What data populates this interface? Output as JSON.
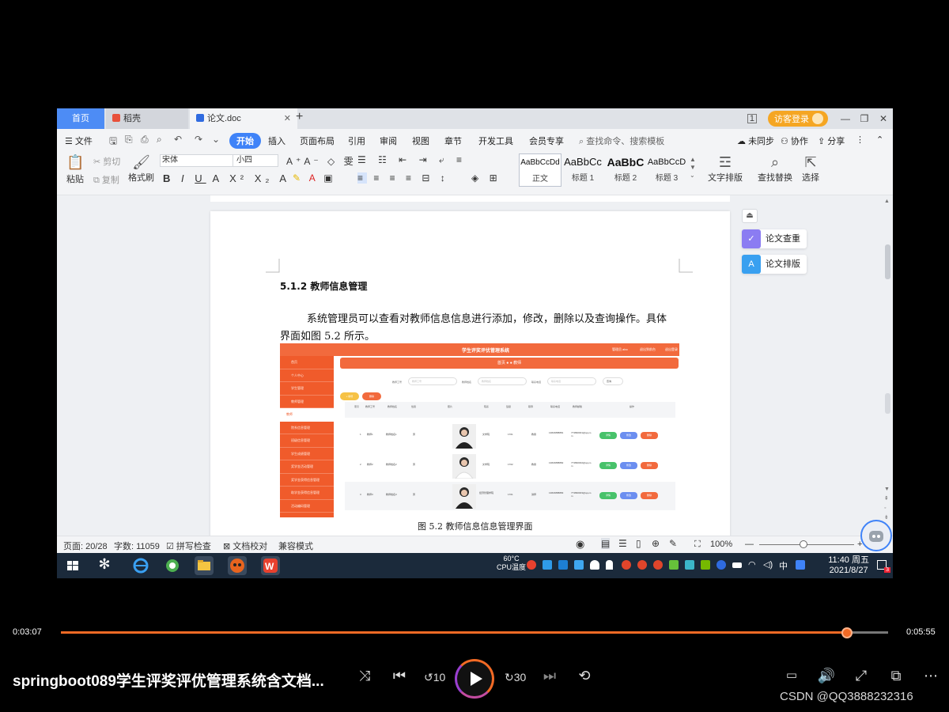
{
  "wps": {
    "tabs": [
      {
        "label": "首页"
      },
      {
        "label": "稻壳"
      },
      {
        "label": "论文.doc"
      }
    ],
    "login_label": "访客登录",
    "menu": {
      "file": "文件",
      "start": "开始",
      "items": [
        "插入",
        "页面布局",
        "引用",
        "审阅",
        "视图",
        "章节",
        "开发工具",
        "会员专享"
      ],
      "search_placeholder": "查找命令、搜索模板",
      "right": [
        "未同步",
        "协作",
        "分享"
      ]
    },
    "ribbon": {
      "paste": "粘贴",
      "cut": "剪切",
      "copy": "复制",
      "format_painter": "格式刷",
      "font": "宋体",
      "size": "小四",
      "styles": [
        {
          "preview": "AaBbCcDd",
          "label": "正文"
        },
        {
          "preview": "AaBbCc",
          "label": "标题 1"
        },
        {
          "preview": "AaBbC",
          "label": "标题 2"
        },
        {
          "preview": "AaBbCcD",
          "label": "标题 3"
        }
      ],
      "text_layout": "文字排版",
      "find_replace": "查找替换",
      "select": "选择"
    },
    "document": {
      "heading": "5.1.2  教师信息管理",
      "paragraph": "系统管理员可以查看对教师信息信息进行添加，修改，删除以及查询操作。具体界面如图 5.2 所示。",
      "caption": "图 5.2  教师信息信息管理界面"
    },
    "embedded": {
      "title": "学生评奖评优管理系统",
      "top_right": [
        "管理员 abo",
        "退出到前台",
        "退出登录"
      ],
      "sidebar": [
        "首页",
        "个人中心",
        "学生管理",
        "教师管理",
        "教师",
        "院系信息管理",
        "班级信息管理",
        "学生成绩管理",
        "奖学金活动管理",
        "奖学金获得信息管理",
        "助学金获得信息管理",
        "活动编码管理"
      ],
      "breadcrumb": "首页 ● ● 教师",
      "filters": [
        {
          "label": "教师工号",
          "placeholder": "教师工号"
        },
        {
          "label": "教师姓名",
          "placeholder": "教师姓名"
        },
        {
          "label": "联系电话",
          "placeholder": "联系电话"
        }
      ],
      "query": "查询",
      "add": "+ 新增",
      "delete": "删除",
      "headers": [
        "索引",
        "教师工号",
        "教师姓名",
        "性别",
        "照片",
        "院系",
        "班级",
        "职称",
        "联系电话",
        "教师邮箱",
        "操作"
      ],
      "rows": [
        {
          "idx": "1",
          "id": "教师1",
          "name": "教师姓名1",
          "sex": "男",
          "dept": "文学院",
          "cls": "1701",
          "title": "教授",
          "phone": "13823888881",
          "email": "773890001@qq.com"
        },
        {
          "idx": "2",
          "id": "教师2",
          "name": "教师姓名2",
          "sex": "男",
          "dept": "文学院",
          "cls": "1702",
          "title": "教授",
          "phone": "13823888882",
          "email": "773890002@qq.com"
        },
        {
          "idx": "3",
          "id": "教师3",
          "name": "教师姓名3",
          "sex": "男",
          "dept": "经济管理学院",
          "cls": "1701",
          "title": "讲师",
          "phone": "13823888883",
          "email": "773890003@qq.com"
        }
      ],
      "actions": [
        "详情",
        "修改",
        "删除"
      ]
    },
    "side_panel": [
      "论文查重",
      "论文排版"
    ],
    "status": {
      "page": "页面: 20/28",
      "words": "字数: 11059",
      "spell": "拼写检查",
      "proof": "文档校对",
      "compat": "兼容模式",
      "zoom": "100%"
    },
    "taskbar": {
      "cpu_temp": "60°C",
      "cpu_label": "CPU温度",
      "ime": "中",
      "time": "11:40 周五",
      "date": "2021/8/27",
      "notif": "3"
    }
  },
  "player": {
    "current": "0:03:07",
    "total": "0:05:55",
    "progress": 0.95,
    "title": "springboot089学生评奖评优管理系统含文档...",
    "watermark": "CSDN @QQ3888232316"
  },
  "colors": {
    "accent": "#f26a25",
    "wps_blue": "#3f83f8",
    "embedded_orange": "#f26a3d"
  }
}
